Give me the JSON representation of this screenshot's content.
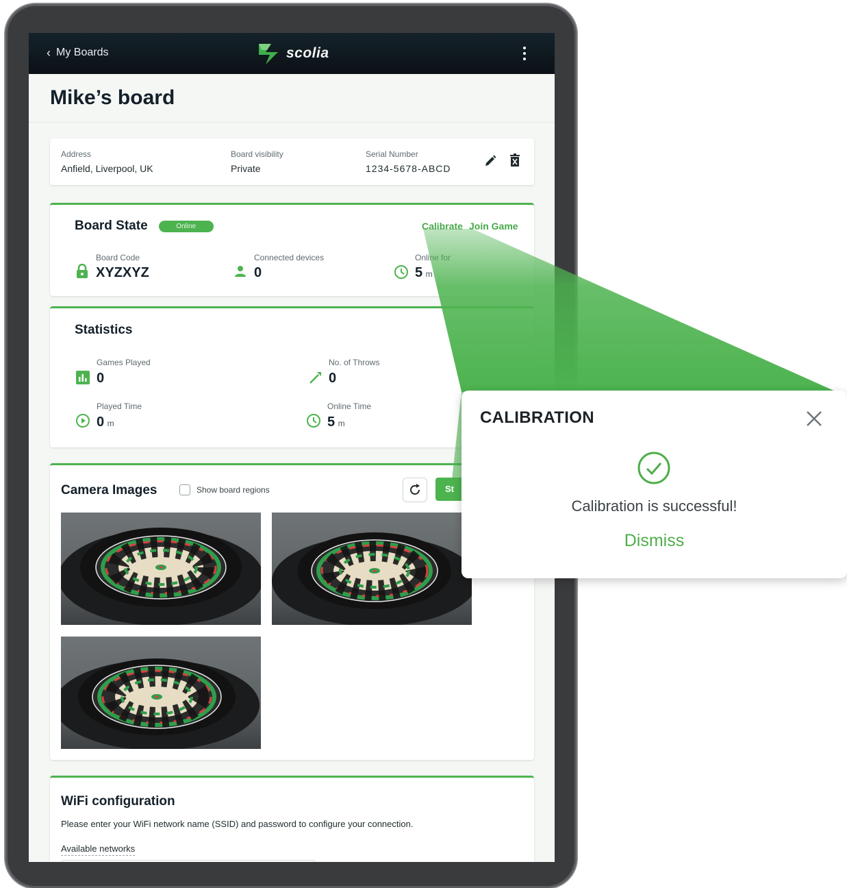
{
  "appbar": {
    "back_label": "My Boards",
    "brand": "scolia"
  },
  "page": {
    "title": "Mike’s board"
  },
  "info": {
    "address_label": "Address",
    "address_value": "Anfield, Liverpool, UK",
    "visibility_label": "Board visibility",
    "visibility_value": "Private",
    "serial_label": "Serial Number",
    "serial_value": "1234-5678-ABCD"
  },
  "board_state": {
    "title": "Board State",
    "status": "Online",
    "calibrate_label": "Calibrate",
    "join_label": "Join Game",
    "code_label": "Board Code",
    "code_value": "XYZXYZ",
    "devices_label": "Connected devices",
    "devices_value": "0",
    "online_label": "Online for",
    "online_value": "5",
    "online_unit": "m"
  },
  "statistics": {
    "title": "Statistics",
    "games_label": "Games Played",
    "games_value": "0",
    "throws_label": "No. of Throws",
    "throws_value": "0",
    "played_label": "Played Time",
    "played_value": "0",
    "played_unit": "m",
    "online_label": "Online Time",
    "online_value": "5",
    "online_unit": "m"
  },
  "camera": {
    "title": "Camera Images",
    "checkbox_label": "Show board regions",
    "start_label": "St"
  },
  "wifi": {
    "title": "WiFi configuration",
    "description": "Please enter your WiFi network name (SSID) and password to configure your connection.",
    "networks_label": "Available networks"
  },
  "dialog": {
    "title": "CALIBRATION",
    "message": "Calibration is successful!",
    "dismiss_label": "Dismiss"
  },
  "colors": {
    "accent": "#4db34f",
    "appbar": "#0e171d",
    "background": "#f5f7f5"
  }
}
